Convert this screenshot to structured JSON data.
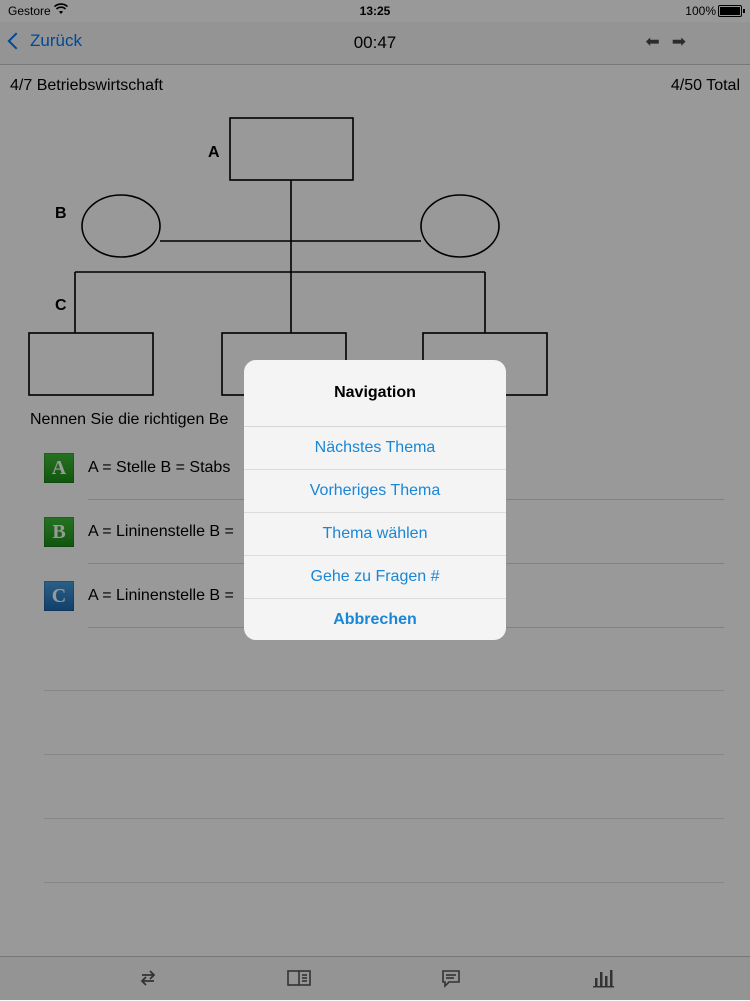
{
  "status": {
    "carrier": "Gestore",
    "time": "13:25",
    "battery": "100%"
  },
  "nav": {
    "back_label": "Zurück",
    "timer": "00:47"
  },
  "header": {
    "topic": "4/7 Betriebswirtschaft",
    "total": "4/50 Total"
  },
  "diagram": {
    "label_a": "A",
    "label_b": "B",
    "label_c": "C"
  },
  "question": {
    "text": "Nennen Sie die richtigen Be"
  },
  "answers": [
    {
      "badge": "A",
      "text": "A = Stelle B = Stabs"
    },
    {
      "badge": "B",
      "text": "A = Lininenstelle B ="
    },
    {
      "badge": "C",
      "text": "A = Lininenstelle B ="
    }
  ],
  "dialog": {
    "title": "Navigation",
    "options": [
      "Nächstes Thema",
      "Vorheriges Thema",
      "Thema wählen",
      "Gehe zu Fragen #"
    ],
    "cancel": "Abbrechen"
  },
  "colors": {
    "accent": "#007aff",
    "dialog_link": "#1a86d6",
    "badge_green": "#2aa826",
    "badge_blue": "#2a7cc4"
  }
}
